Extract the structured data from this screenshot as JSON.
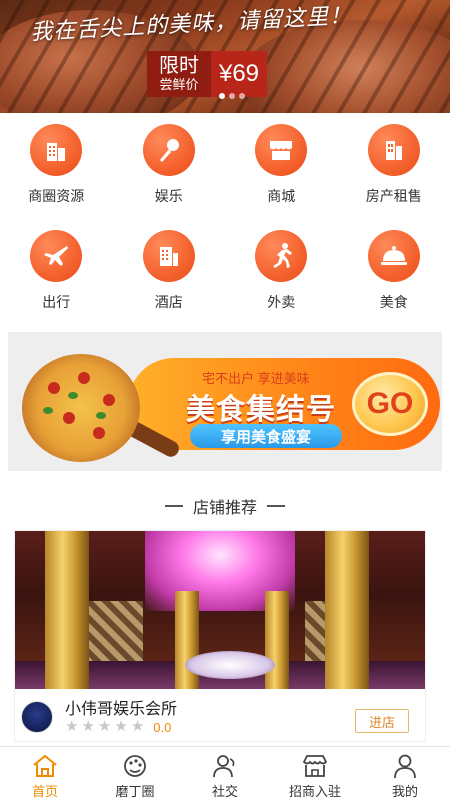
{
  "banner": {
    "slogan": "我在舌尖上的美味，请留这里！",
    "badge_line1": "限时",
    "badge_line2": "尝鲜价",
    "price": "¥69",
    "dots": 3,
    "active_dot": 0
  },
  "categories": [
    {
      "label": "商圈资源",
      "icon": "buildings-icon"
    },
    {
      "label": "娱乐",
      "icon": "microphone-icon"
    },
    {
      "label": "商城",
      "icon": "storefront-icon"
    },
    {
      "label": "房产租售",
      "icon": "building-icon"
    },
    {
      "label": "出行",
      "icon": "airplane-icon"
    },
    {
      "label": "酒店",
      "icon": "hotel-icon"
    },
    {
      "label": "外卖",
      "icon": "runner-icon"
    },
    {
      "label": "美食",
      "icon": "cloche-icon"
    }
  ],
  "promo": {
    "subtitle": "宅不出户 享进美味",
    "title": "美食集结号",
    "tag": "享用美食盛宴",
    "go": "GO"
  },
  "section": {
    "title": "店铺推荐"
  },
  "store": {
    "name": "小伟哥娱乐会所",
    "rating": "0.0",
    "stars_filled": 0,
    "stars_total": 5,
    "enter_label": "进店"
  },
  "nav": {
    "items": [
      {
        "label": "首页",
        "icon": "home-icon",
        "active": true
      },
      {
        "label": "磨丁圈",
        "icon": "palette-icon",
        "active": false
      },
      {
        "label": "社交",
        "icon": "social-icon",
        "active": false
      },
      {
        "label": "招商入驻",
        "icon": "shop-icon",
        "active": false
      },
      {
        "label": "我的",
        "icon": "user-icon",
        "active": false
      }
    ]
  },
  "colors": {
    "accent": "#f4622e",
    "active_nav": "#f08a00"
  }
}
